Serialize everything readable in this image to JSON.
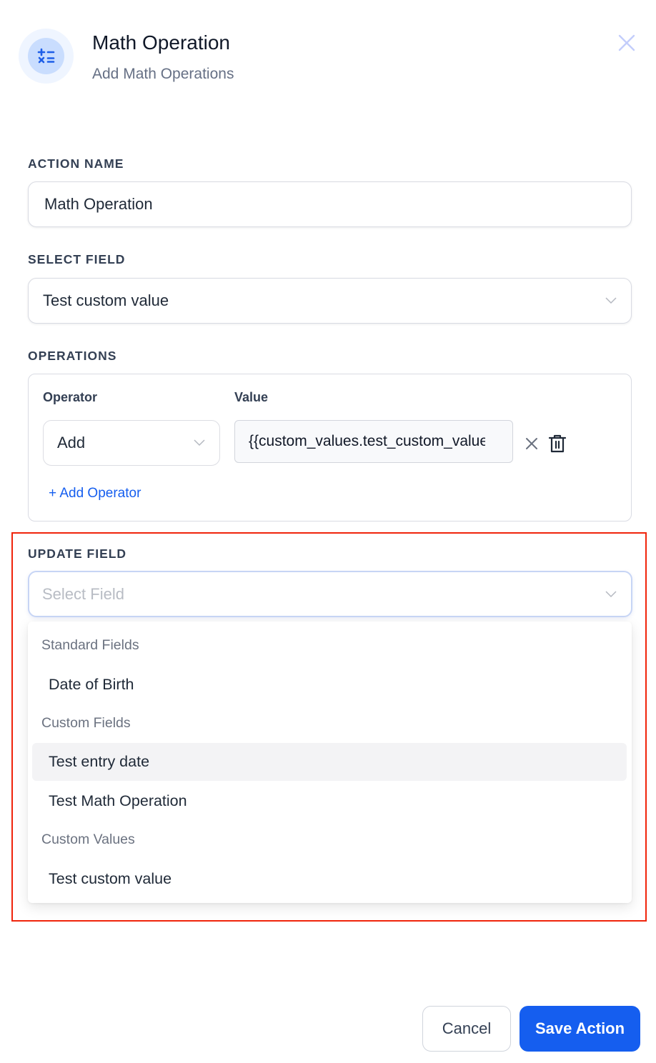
{
  "header": {
    "title": "Math Operation",
    "subtitle": "Add Math Operations",
    "icon": "math-operators-icon",
    "close_icon": "close-icon"
  },
  "action_name": {
    "label": "ACTION NAME",
    "value": "Math Operation"
  },
  "select_field": {
    "label": "SELECT FIELD",
    "value": "Test custom value"
  },
  "operations": {
    "label": "OPERATIONS",
    "operator_header": "Operator",
    "value_header": "Value",
    "rows": [
      {
        "operator": "Add",
        "value": "{{custom_values.test_custom_value}}"
      }
    ],
    "add_operator_label": "+ Add Operator"
  },
  "update_field": {
    "label": "UPDATE FIELD",
    "placeholder": "Select Field",
    "dropdown": {
      "groups": [
        {
          "label": "Standard Fields",
          "options": [
            "Date of Birth"
          ]
        },
        {
          "label": "Custom Fields",
          "options": [
            "Test entry date",
            "Test Math Operation"
          ]
        },
        {
          "label": "Custom Values",
          "options": [
            "Test custom value"
          ]
        }
      ],
      "hovered_option": "Test entry date"
    }
  },
  "footer": {
    "cancel_label": "Cancel",
    "save_label": "Save Action"
  },
  "colors": {
    "accent": "#155eef",
    "highlight_border": "#f0240b",
    "icon_bg": "#c9ddfe"
  }
}
